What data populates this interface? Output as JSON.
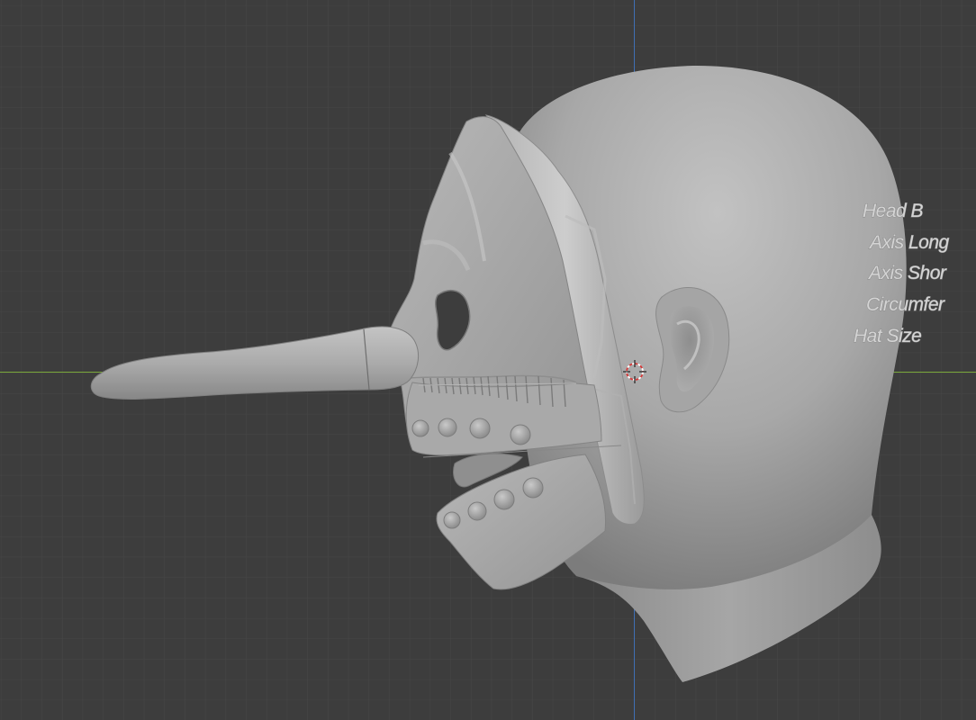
{
  "viewport": {
    "view": "right-orthographic",
    "grid": true,
    "background_color": "#3d3d3d",
    "grid_color": "#494949",
    "x_axis_color": "#7aa83a",
    "z_axis_color": "#3f6fb5",
    "shading": "solid",
    "model_color": "#a3a3a3"
  },
  "scene": {
    "object": "head-with-mask-sculpt",
    "cursor": "3d-cursor"
  },
  "embossed_text": [
    "Head B",
    "Axis Long",
    "Axis Shor",
    "Circumfer",
    "Hat Size"
  ]
}
